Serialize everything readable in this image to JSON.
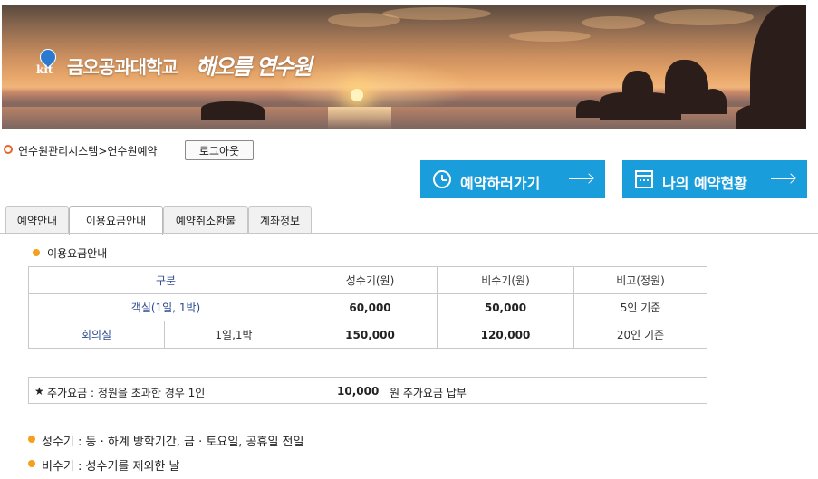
{
  "banner": {
    "logo_mark": "kit",
    "university": "금오공과대학교",
    "center_name": "해오름 연수원"
  },
  "breadcrumb": "연수원관리시스템>연수원예약",
  "logout_label": "로그아웃",
  "actions": [
    {
      "label": "예약하러가기",
      "icon": "clock-icon"
    },
    {
      "label": "나의 예약현황",
      "icon": "calendar-icon"
    }
  ],
  "tabs": [
    "예약안내",
    "이용요금안내",
    "예약취소환불",
    "계좌정보"
  ],
  "active_tab": "이용요금안내",
  "section_title": "이용요금안내",
  "table": {
    "headers": [
      "구분",
      "성수기(원)",
      "비수기(원)",
      "비고(정원)"
    ],
    "rows": [
      {
        "category": "객실(1일, 1박)",
        "sub": "",
        "peak": "60,000",
        "offpeak": "50,000",
        "note": "5인 기준"
      },
      {
        "category": "회의실",
        "sub": "1일,1박",
        "peak": "150,000",
        "offpeak": "120,000",
        "note": "20인 기준"
      }
    ]
  },
  "extra_fee": {
    "star": "★",
    "text": "추가요금 : 정원을 초과한 경우 1인",
    "amount": "10,000",
    "unit": "원 추가요금 납부"
  },
  "notes": [
    "성수기 : 동 · 하계 방학기간, 금 · 토요일, 공휴일 전일",
    "비수기 : 성수기를 제외한 날"
  ],
  "colors": {
    "accent_blue": "#1a9ddb",
    "bullet_orange": "#f5a01a",
    "breadcrumb_orange": "#e8662a",
    "table_blue_text": "#2e4c91"
  }
}
